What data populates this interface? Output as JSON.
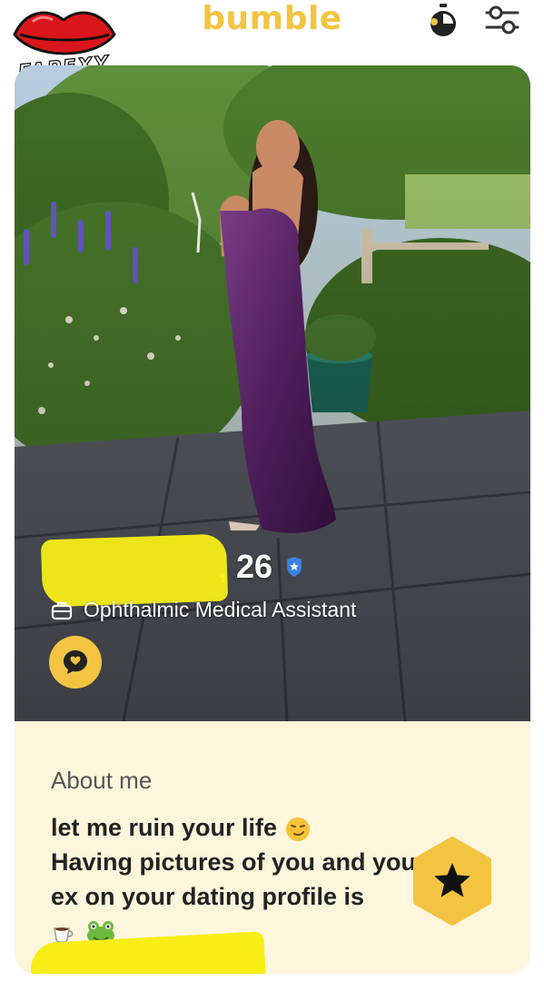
{
  "header": {
    "brand": "bumble",
    "watermark": "FAPEXY"
  },
  "profile": {
    "name": "",
    "age_label": ", 26",
    "job_title": "Ophthalmic Medical Assistant"
  },
  "about": {
    "heading": "About me",
    "lines": [
      "let me ruin your life",
      "Having pictures of you and your",
      "ex on your dating profile is"
    ]
  },
  "colors": {
    "brand_yellow": "#f3c442",
    "about_background": "#fdf6dc",
    "verified_blue": "#3b82e0",
    "redaction_yellow": "#f7ee17"
  }
}
